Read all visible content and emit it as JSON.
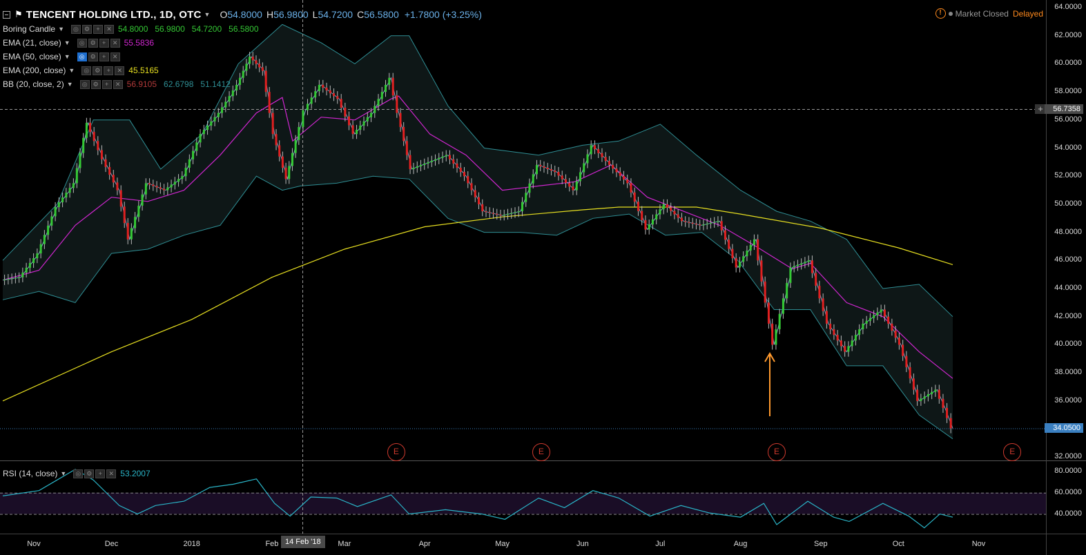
{
  "header": {
    "symbol_title": "TENCENT HOLDING LTD., 1D, OTC",
    "ohlc": [
      {
        "key": "O",
        "value": "54.8000"
      },
      {
        "key": "H",
        "value": "56.9800"
      },
      {
        "key": "L",
        "value": "54.7200"
      },
      {
        "key": "C",
        "value": "56.5800"
      }
    ],
    "change": "+1.7800 (+3.25%)"
  },
  "status": {
    "warning_icon": "!",
    "market_state": "Market Closed",
    "delay": "Delayed"
  },
  "indicators": [
    {
      "name": "Boring Candle",
      "values": [
        "54.8000",
        "56.9800",
        "54.7200",
        "56.5800"
      ],
      "value_colors": [
        "#35c935",
        "#35c935",
        "#35c935",
        "#35c935"
      ]
    },
    {
      "name": "EMA (21, close)",
      "values": [
        "55.5836"
      ],
      "value_colors": [
        "#d026d0"
      ]
    },
    {
      "name": "EMA (50, close)",
      "values": [],
      "value_colors": []
    },
    {
      "name": "EMA (200, close)",
      "values": [
        "45.5165"
      ],
      "value_colors": [
        "#e8e020"
      ]
    },
    {
      "name": "BB (20, close, 2)",
      "values": [
        "56.9105",
        "62.6798",
        "51.1412"
      ],
      "value_colors": [
        "#b23a3a",
        "#2f8f95",
        "#2f8f95"
      ]
    }
  ],
  "rsi": {
    "name": "RSI (14, close)",
    "value": "53.2007",
    "levels": [
      40,
      60
    ],
    "axis": [
      "80.0000",
      "60.0000",
      "40.0000"
    ]
  },
  "price_axis": [
    "64.0000",
    "62.0000",
    "60.0000",
    "58.0000",
    "56.0000",
    "54.0000",
    "52.0000",
    "50.0000",
    "48.0000",
    "46.0000",
    "44.0000",
    "42.0000",
    "40.0000",
    "38.0000",
    "36.0000",
    "34.0000",
    "32.0000"
  ],
  "time_axis": [
    "Nov",
    "Dec",
    "2018",
    "Feb",
    "Mar",
    "Apr",
    "May",
    "Jun",
    "Jul",
    "Aug",
    "Sep",
    "Oct",
    "Nov"
  ],
  "crosshair": {
    "price": "56.7358",
    "date": "14 Feb '18"
  },
  "last_price": "34.0500",
  "earnings_marker": "E",
  "colors": {
    "up": "#35c935",
    "down": "#e02020",
    "ema21": "#d026d0",
    "ema200": "#e8e020",
    "bb": "#2f8f95",
    "rsi": "#2ab5c8",
    "rsi_band": "#1a0d26",
    "arrow": "#ff9a2e"
  },
  "chart_data": {
    "type": "candlestick",
    "period": "1D",
    "x_range": [
      "2017-10-20",
      "2018-10-22"
    ],
    "ylim": [
      31.5,
      64.2
    ],
    "close_path": [
      [
        "2017-10-20",
        44.6
      ],
      [
        "2017-10-27",
        44.8
      ],
      [
        "2017-11-03",
        46.5
      ],
      [
        "2017-11-10",
        49.8
      ],
      [
        "2017-11-17",
        51.5
      ],
      [
        "2017-11-22",
        55.8
      ],
      [
        "2017-11-28",
        53.2
      ],
      [
        "2017-12-04",
        51.0
      ],
      [
        "2017-12-08",
        47.5
      ],
      [
        "2017-12-15",
        51.5
      ],
      [
        "2017-12-22",
        51.0
      ],
      [
        "2017-12-29",
        52.0
      ],
      [
        "2018-01-05",
        55.0
      ],
      [
        "2018-01-12",
        56.5
      ],
      [
        "2018-01-19",
        58.5
      ],
      [
        "2018-01-24",
        60.5
      ],
      [
        "2018-01-29",
        59.5
      ],
      [
        "2018-02-02",
        55.0
      ],
      [
        "2018-02-07",
        51.8
      ],
      [
        "2018-02-12",
        55.5
      ],
      [
        "2018-02-14",
        56.7
      ],
      [
        "2018-02-20",
        58.5
      ],
      [
        "2018-02-27",
        57.5
      ],
      [
        "2018-03-05",
        55.0
      ],
      [
        "2018-03-12",
        56.5
      ],
      [
        "2018-03-19",
        59.0
      ],
      [
        "2018-03-22",
        56.5
      ],
      [
        "2018-03-27",
        52.5
      ],
      [
        "2018-04-03",
        53.0
      ],
      [
        "2018-04-10",
        53.5
      ],
      [
        "2018-04-17",
        52.0
      ],
      [
        "2018-04-24",
        49.5
      ],
      [
        "2018-05-01",
        49.2
      ],
      [
        "2018-05-08",
        49.5
      ],
      [
        "2018-05-15",
        52.8
      ],
      [
        "2018-05-22",
        52.3
      ],
      [
        "2018-05-29",
        51.0
      ],
      [
        "2018-06-05",
        54.2
      ],
      [
        "2018-06-12",
        52.8
      ],
      [
        "2018-06-19",
        51.5
      ],
      [
        "2018-06-26",
        48.2
      ],
      [
        "2018-07-03",
        50.0
      ],
      [
        "2018-07-10",
        48.8
      ],
      [
        "2018-07-17",
        48.5
      ],
      [
        "2018-07-24",
        48.8
      ],
      [
        "2018-07-31",
        45.5
      ],
      [
        "2018-08-07",
        47.5
      ],
      [
        "2018-08-14",
        40.0
      ],
      [
        "2018-08-21",
        45.5
      ],
      [
        "2018-08-28",
        46.0
      ],
      [
        "2018-09-04",
        41.5
      ],
      [
        "2018-09-11",
        39.5
      ],
      [
        "2018-09-18",
        41.5
      ],
      [
        "2018-09-25",
        42.5
      ],
      [
        "2018-10-02",
        40.0
      ],
      [
        "2018-10-09",
        36.0
      ],
      [
        "2018-10-16",
        36.8
      ],
      [
        "2018-10-19",
        35.5
      ],
      [
        "2018-10-22",
        34.05
      ]
    ],
    "ema21": [
      [
        "2017-10-20",
        44.6
      ],
      [
        "2017-11-03",
        45.3
      ],
      [
        "2017-11-17",
        48.5
      ],
      [
        "2017-12-01",
        50.5
      ],
      [
        "2017-12-15",
        50.2
      ],
      [
        "2017-12-29",
        51.0
      ],
      [
        "2018-01-12",
        53.5
      ],
      [
        "2018-01-26",
        56.5
      ],
      [
        "2018-02-05",
        57.6
      ],
      [
        "2018-02-09",
        54.5
      ],
      [
        "2018-02-20",
        56.2
      ],
      [
        "2018-03-05",
        56.0
      ],
      [
        "2018-03-19",
        57.5
      ],
      [
        "2018-03-22",
        57.7
      ],
      [
        "2018-04-03",
        55.0
      ],
      [
        "2018-04-17",
        53.5
      ],
      [
        "2018-05-01",
        51.0
      ],
      [
        "2018-05-15",
        51.3
      ],
      [
        "2018-05-29",
        51.6
      ],
      [
        "2018-06-12",
        52.8
      ],
      [
        "2018-06-26",
        50.5
      ],
      [
        "2018-07-10",
        49.5
      ],
      [
        "2018-07-24",
        48.5
      ],
      [
        "2018-08-07",
        47.0
      ],
      [
        "2018-08-21",
        45.4
      ],
      [
        "2018-08-28",
        45.8
      ],
      [
        "2018-09-11",
        43.0
      ],
      [
        "2018-09-25",
        42.0
      ],
      [
        "2018-10-09",
        39.5
      ],
      [
        "2018-10-22",
        37.6
      ]
    ],
    "ema200": [
      [
        "2017-10-20",
        36.0
      ],
      [
        "2017-12-01",
        39.5
      ],
      [
        "2018-01-01",
        41.8
      ],
      [
        "2018-02-01",
        44.8
      ],
      [
        "2018-03-01",
        46.8
      ],
      [
        "2018-04-01",
        48.4
      ],
      [
        "2018-05-01",
        49.1
      ],
      [
        "2018-06-01",
        49.6
      ],
      [
        "2018-06-15",
        49.8
      ],
      [
        "2018-07-15",
        49.8
      ],
      [
        "2018-08-01",
        49.3
      ],
      [
        "2018-09-01",
        48.3
      ],
      [
        "2018-10-01",
        46.9
      ],
      [
        "2018-10-22",
        45.7
      ]
    ],
    "bb_upper": [
      [
        "2017-10-20",
        46.0
      ],
      [
        "2017-11-10",
        50.0
      ],
      [
        "2017-11-24",
        56.0
      ],
      [
        "2017-12-08",
        56.0
      ],
      [
        "2017-12-20",
        52.5
      ],
      [
        "2018-01-05",
        55.0
      ],
      [
        "2018-01-19",
        60.0
      ],
      [
        "2018-02-05",
        62.8
      ],
      [
        "2018-02-20",
        61.5
      ],
      [
        "2018-03-05",
        60.0
      ],
      [
        "2018-03-19",
        62.0
      ],
      [
        "2018-03-26",
        62.0
      ],
      [
        "2018-04-10",
        57.0
      ],
      [
        "2018-04-24",
        54.0
      ],
      [
        "2018-05-15",
        53.5
      ],
      [
        "2018-06-01",
        54.2
      ],
      [
        "2018-06-15",
        54.5
      ],
      [
        "2018-07-01",
        55.7
      ],
      [
        "2018-07-15",
        53.5
      ],
      [
        "2018-08-01",
        51.0
      ],
      [
        "2018-08-15",
        49.5
      ],
      [
        "2018-08-28",
        48.8
      ],
      [
        "2018-09-11",
        47.5
      ],
      [
        "2018-09-25",
        44.0
      ],
      [
        "2018-10-09",
        44.3
      ],
      [
        "2018-10-22",
        42.0
      ]
    ],
    "bb_lower": [
      [
        "2017-10-20",
        43.2
      ],
      [
        "2017-11-03",
        43.8
      ],
      [
        "2017-11-17",
        43.0
      ],
      [
        "2017-12-01",
        46.5
      ],
      [
        "2017-12-15",
        46.8
      ],
      [
        "2017-12-29",
        47.8
      ],
      [
        "2018-01-12",
        48.5
      ],
      [
        "2018-01-26",
        52.0
      ],
      [
        "2018-02-05",
        51.0
      ],
      [
        "2018-02-12",
        51.3
      ],
      [
        "2018-02-26",
        51.5
      ],
      [
        "2018-03-12",
        52.0
      ],
      [
        "2018-03-26",
        51.8
      ],
      [
        "2018-04-10",
        49.0
      ],
      [
        "2018-04-24",
        48.0
      ],
      [
        "2018-05-08",
        48.0
      ],
      [
        "2018-05-22",
        47.8
      ],
      [
        "2018-06-05",
        49.0
      ],
      [
        "2018-06-19",
        49.3
      ],
      [
        "2018-07-03",
        47.8
      ],
      [
        "2018-07-17",
        48.0
      ],
      [
        "2018-07-31",
        46.0
      ],
      [
        "2018-08-14",
        42.5
      ],
      [
        "2018-08-28",
        42.5
      ],
      [
        "2018-09-11",
        38.5
      ],
      [
        "2018-09-25",
        38.5
      ],
      [
        "2018-10-09",
        35.0
      ],
      [
        "2018-10-22",
        33.3
      ]
    ],
    "rsi_path": [
      [
        "2017-10-20",
        57
      ],
      [
        "2017-11-03",
        62
      ],
      [
        "2017-11-10",
        72
      ],
      [
        "2017-11-17",
        82
      ],
      [
        "2017-11-24",
        72
      ],
      [
        "2017-12-04",
        48
      ],
      [
        "2017-12-11",
        40
      ],
      [
        "2017-12-18",
        48
      ],
      [
        "2017-12-29",
        52
      ],
      [
        "2018-01-08",
        65
      ],
      [
        "2018-01-17",
        68
      ],
      [
        "2018-01-26",
        73
      ],
      [
        "2018-02-02",
        50
      ],
      [
        "2018-02-08",
        38
      ],
      [
        "2018-02-16",
        56
      ],
      [
        "2018-02-26",
        55
      ],
      [
        "2018-03-06",
        47
      ],
      [
        "2018-03-19",
        58
      ],
      [
        "2018-03-26",
        40
      ],
      [
        "2018-04-09",
        44
      ],
      [
        "2018-04-23",
        40
      ],
      [
        "2018-05-02",
        35
      ],
      [
        "2018-05-15",
        55
      ],
      [
        "2018-05-25",
        46
      ],
      [
        "2018-06-05",
        62
      ],
      [
        "2018-06-15",
        55
      ],
      [
        "2018-06-27",
        38
      ],
      [
        "2018-07-09",
        48
      ],
      [
        "2018-07-20",
        41
      ],
      [
        "2018-08-01",
        37
      ],
      [
        "2018-08-10",
        50
      ],
      [
        "2018-08-15",
        30
      ],
      [
        "2018-08-27",
        52
      ],
      [
        "2018-09-06",
        37
      ],
      [
        "2018-09-12",
        33
      ],
      [
        "2018-09-25",
        50
      ],
      [
        "2018-10-05",
        38
      ],
      [
        "2018-10-11",
        27
      ],
      [
        "2018-10-17",
        40
      ],
      [
        "2018-10-22",
        37
      ]
    ],
    "earnings_dates": [
      "2018-03-21",
      "2018-05-16",
      "2018-08-15",
      "2018-11-14"
    ]
  }
}
